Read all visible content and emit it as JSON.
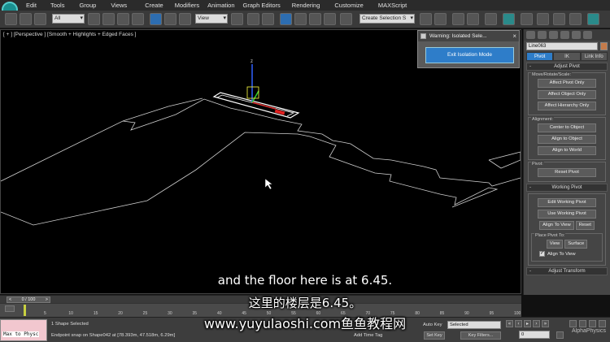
{
  "menubar": {
    "items": [
      "Edit",
      "Tools",
      "Group",
      "Views",
      "Create",
      "Modifiers",
      "Animation",
      "Graph Editors",
      "Rendering",
      "Customize",
      "MAXScript"
    ]
  },
  "toolbar": {
    "selection_filter": "All",
    "reference_coord": "View",
    "named_selection": "Create Selection S"
  },
  "viewport": {
    "label": "[ + ] [Perspective ] [Smooth + Highlights + Edged Faces ]",
    "gizmo_axis_label": "z"
  },
  "isolation_dialog": {
    "title": "Warning: Isolated Sele...",
    "close_glyph": "×",
    "button": "Exit Isolation Mode"
  },
  "command_panel": {
    "object_name": "Line063",
    "object_color": "#c67b4a",
    "tabs": [
      {
        "label": "Pivot",
        "active": true
      },
      {
        "label": "IK",
        "active": false
      },
      {
        "label": "Link Info",
        "active": false
      }
    ],
    "adjust_pivot": {
      "header": "Adjust Pivot",
      "move_rotate_scale_label": "Move/Rotate/Scale:",
      "move_buttons": [
        "Affect Pivot Only",
        "Affect Object Only",
        "Affect Hierarchy Only"
      ],
      "alignment_label": "Alignment:",
      "alignment_buttons": [
        "Center to Object",
        "Align to Object",
        "Align to World"
      ],
      "pivot_label": "Pivot:",
      "reset_pivot": "Reset Pivot"
    },
    "working_pivot": {
      "header": "Working Pivot",
      "edit_button": "Edit Working Pivot",
      "use_button": "Use Working Pivot",
      "align_to_view": "Align To View",
      "reset": "Reset",
      "place_pivot_label": "Place Pivot To:",
      "view": "View",
      "surface": "Surface",
      "align_to_view_checkbox": "Align To View"
    },
    "adjust_transform_header": "Adjust Transform"
  },
  "timeline": {
    "slider_label": "0 / 100",
    "ticks": [
      "5",
      "10",
      "15",
      "20",
      "25",
      "30",
      "35",
      "40",
      "45",
      "50",
      "55",
      "60",
      "65",
      "70",
      "75",
      "80",
      "85",
      "90",
      "95",
      "100"
    ]
  },
  "statusbar": {
    "listener_text": "Max to Physc",
    "selection_info": "1 Shape Selected",
    "prompt": "Endpoint snap on Shape042 at [78.393m, 47.518m, 6.29m]",
    "add_time_tag": "Add Time Tag",
    "auto_key": "Auto Key",
    "set_key": "Set Key",
    "key_mode": "Selected",
    "key_filters": "Key Filters...",
    "frame": "0"
  },
  "subtitles": {
    "english": "and the floor here is at 6.45.",
    "chinese": "这里的楼层是6.45。",
    "url": "www.yuyulaoshi.com鱼鱼教程网"
  },
  "watermark": "AlphaPhysics"
}
